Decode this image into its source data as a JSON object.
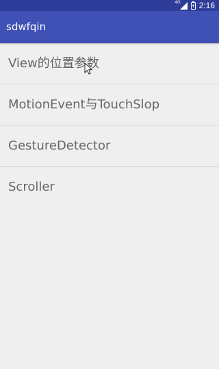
{
  "status_bar": {
    "network_label": "4G",
    "time": "2:16",
    "background_color": "#2f3d9a",
    "icons": [
      "signal-icon",
      "battery-icon"
    ]
  },
  "app_bar": {
    "title": "sdwfqin",
    "background_color": "#3f51b5"
  },
  "list": {
    "items": [
      {
        "label": "View的位置参数"
      },
      {
        "label": "MotionEvent与TouchSlop"
      },
      {
        "label": "GestureDetector"
      },
      {
        "label": "Scroller"
      }
    ]
  },
  "pointer": {
    "icon": "mouse-pointer-icon"
  }
}
